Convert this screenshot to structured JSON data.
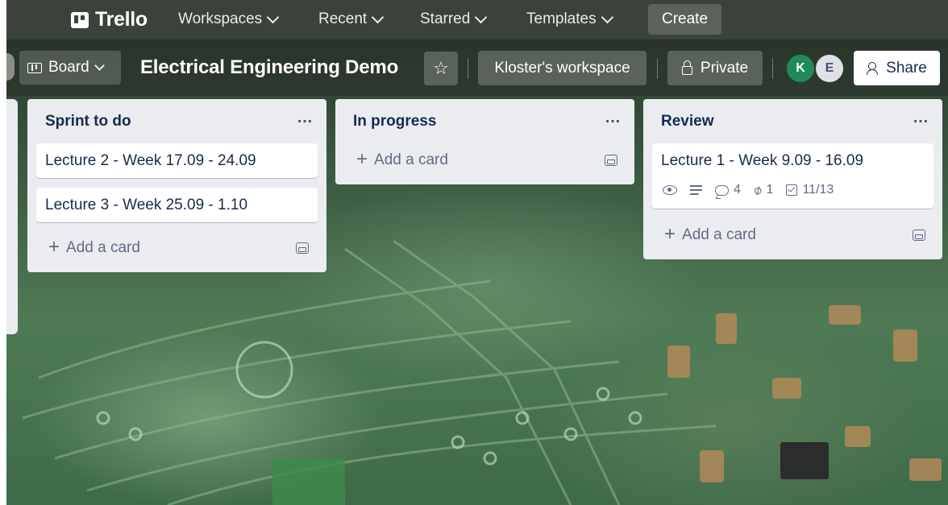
{
  "app": {
    "name": "Trello",
    "nav": {
      "workspaces": "Workspaces",
      "recent": "Recent",
      "starred": "Starred",
      "templates": "Templates",
      "create": "Create"
    }
  },
  "board": {
    "view_label": "Board",
    "title": "Electrical Engineering Demo",
    "workspace": "Kloster's workspace",
    "visibility": "Private",
    "members": [
      {
        "initial": "K",
        "color": "#1e8a5a"
      },
      {
        "initial": "E",
        "color": "#dfe1e6"
      }
    ],
    "share_label": "Share"
  },
  "lists": [
    {
      "title": "Sprint to do",
      "menu": "…",
      "cards": [
        {
          "title": "Lecture 2 - Week 17.09 - 24.09"
        },
        {
          "title": "Lecture 3 - Week 25.09 - 1.10"
        }
      ],
      "add_card": "Add a card"
    },
    {
      "title": "In progress",
      "menu": "…",
      "cards": [],
      "add_card": "Add a card"
    },
    {
      "title": "Review",
      "menu": "…",
      "cards": [
        {
          "title": "Lecture 1 - Week 9.09 - 16.09",
          "badges": {
            "comments": "4",
            "attachments": "1",
            "checklist": "11/13"
          }
        }
      ],
      "add_card": "Add a card"
    }
  ],
  "icons": [
    "trello-logo-icon",
    "chevron-down-icon",
    "board-icon",
    "star-icon",
    "lock-icon",
    "share-icon",
    "more-icon",
    "plus-icon",
    "template-icon",
    "eye-icon",
    "description-icon",
    "comment-icon",
    "attachment-icon",
    "checklist-icon"
  ]
}
